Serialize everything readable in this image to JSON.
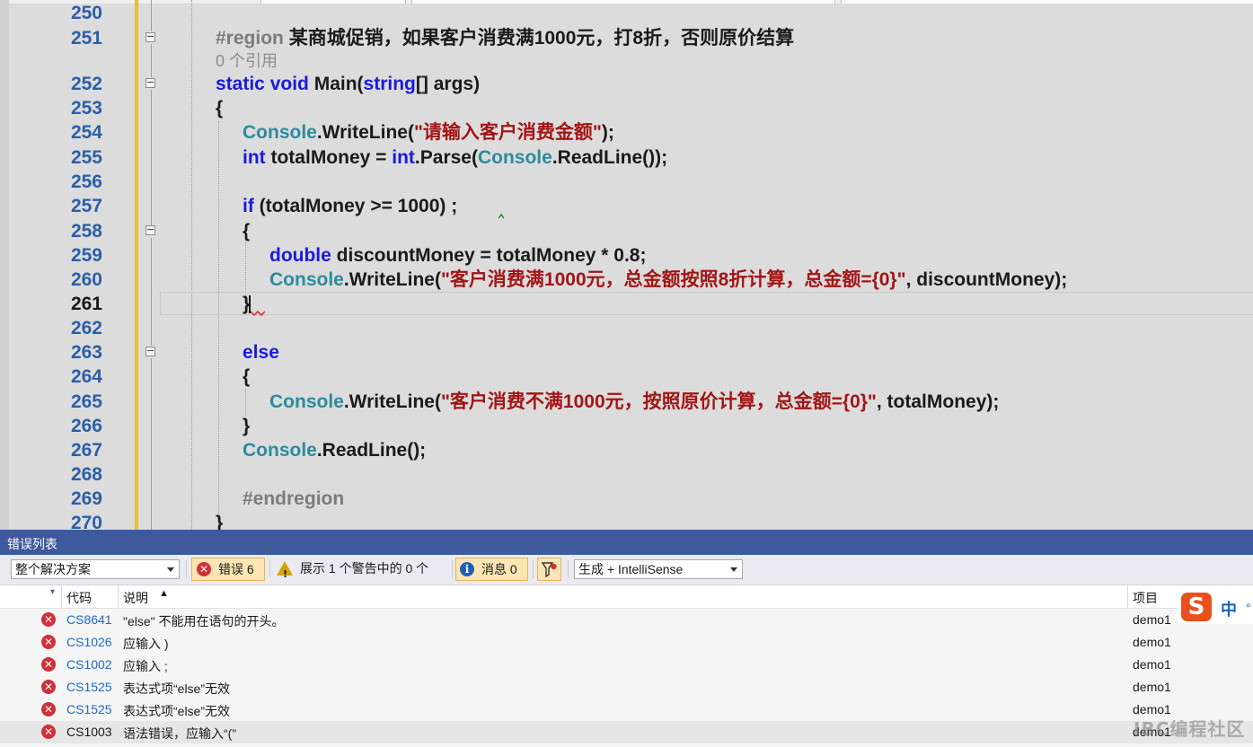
{
  "editor": {
    "lines": [
      {
        "num": "250"
      },
      {
        "num": "251",
        "region": "#region",
        "region_title": "某商城促销，如果客户消费满1000元，打8折，否则原价结算",
        "refs": "0 个引用"
      },
      {
        "num": "252",
        "kw_static": "static",
        "kw_void": "void",
        "method": "Main(",
        "kw_string": "string",
        "rest": "[] args)"
      },
      {
        "num": "253",
        "text": "{"
      },
      {
        "num": "254",
        "type": "Console",
        "call": ".WriteLine(",
        "str": "\"请输入客户消费金额\"",
        "tail": ");"
      },
      {
        "num": "255",
        "kw": "int",
        "mid": " totalMoney = ",
        "kw2": "int",
        "parse": ".Parse(",
        "type": "Console",
        "tail": ".ReadLine());"
      },
      {
        "num": "256"
      },
      {
        "num": "257",
        "kw": "if",
        "rest": " (totalMoney >= 1000) ;"
      },
      {
        "num": "258",
        "text": "{"
      },
      {
        "num": "259",
        "kw": "double",
        "rest": " discountMoney = totalMoney * 0.8;"
      },
      {
        "num": "260",
        "type": "Console",
        "call": ".WriteLine(",
        "str": "\"客户消费满1000元，总金额按照8折计算，总金额={0}\"",
        "tail": ", discountMoney);"
      },
      {
        "num": "261",
        "text": "}"
      },
      {
        "num": "262"
      },
      {
        "num": "263",
        "kw": "else"
      },
      {
        "num": "264",
        "text": "{"
      },
      {
        "num": "265",
        "type": "Console",
        "call": ".WriteLine(",
        "str": "\"客户消费不满1000元，按照原价计算，总金额={0}\"",
        "tail": ", totalMoney);"
      },
      {
        "num": "266",
        "text": "}"
      },
      {
        "num": "267",
        "type": "Console",
        "tail": ".ReadLine();"
      },
      {
        "num": "268"
      },
      {
        "num": "269",
        "region": "#endregion"
      },
      {
        "num": "270",
        "text": "}"
      }
    ]
  },
  "error_list": {
    "title": "错误列表",
    "scope": "整个解决方案",
    "errors_label": "错误 6",
    "warnings_label": "展示 1 个警告中的 0 个",
    "messages_label": "消息 0",
    "build_filter": "生成 + IntelliSense",
    "columns": {
      "code": "代码",
      "description": "说明",
      "project": "项目"
    },
    "rows": [
      {
        "code": "CS8641",
        "description": "\"else\" 不能用在语句的开头。",
        "project": "demo1"
      },
      {
        "code": "CS1026",
        "description": "应输入 )",
        "project": "demo1"
      },
      {
        "code": "CS1002",
        "description": "应输入 ;",
        "project": "demo1"
      },
      {
        "code": "CS1525",
        "description": "表达式项“else”无效",
        "project": "demo1"
      },
      {
        "code": "CS1525",
        "description": "表达式项“else”无效",
        "project": "demo1"
      },
      {
        "code": "CS1003",
        "description": "语法错误，应输入“(”",
        "project": "demo1"
      }
    ]
  },
  "ime": {
    "logo": "S",
    "lang": "中",
    "extra": "°"
  },
  "watermark": "IBC编程社区",
  "colors": {
    "keyword": "#1a1add",
    "type": "#2b8c9e",
    "string": "#a31515",
    "title_bar": "#3e5a9c",
    "error": "#d12f3a"
  }
}
